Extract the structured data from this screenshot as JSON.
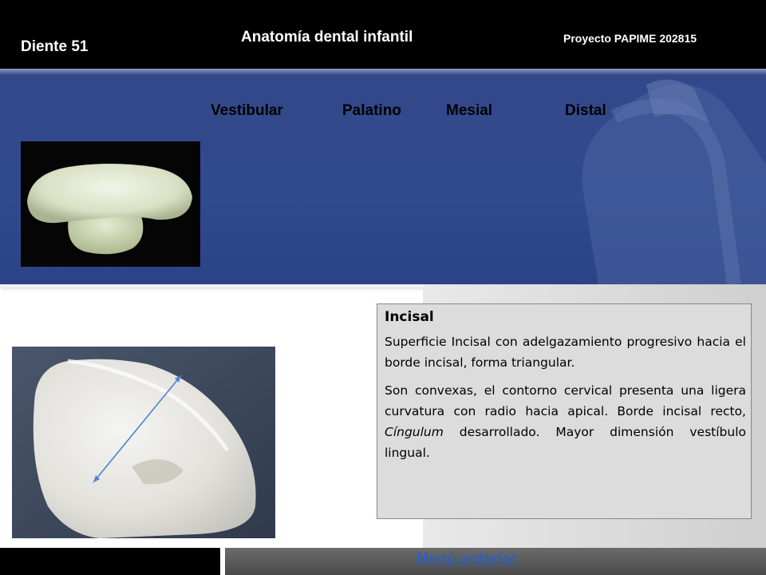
{
  "header": {
    "tooth_label": "Diente  51",
    "title": "Anatomía dental  infantil",
    "project": "Proyecto  PAPIME 202815"
  },
  "tabs": [
    {
      "label": "Vestibular"
    },
    {
      "label": "Palatino"
    },
    {
      "label": "Mesial"
    },
    {
      "label": "Distal"
    }
  ],
  "content": {
    "heading": "Incisal",
    "paragraph1": "Superficie Incisal con adelgazamiento progresivo hacia el borde incisal, forma triangular.",
    "paragraph2_part1": "Son convexas, el contorno cervical presenta una ligera curvatura con radio hacia apical. Borde incisal recto, ",
    "paragraph2_italic": "Cíngulum",
    "paragraph2_part2": " desarrollado. Mayor dimensión vestíbulo lingual."
  },
  "footer": {
    "menu_link": "Menú anterior"
  },
  "colors": {
    "header_bg": "#000000",
    "band_blue": "#304a8e",
    "link_blue": "#1f5fd8",
    "textbox_bg": "#dcdcdc"
  },
  "icons": {
    "measurement_arrow": "double-headed-arrow"
  }
}
